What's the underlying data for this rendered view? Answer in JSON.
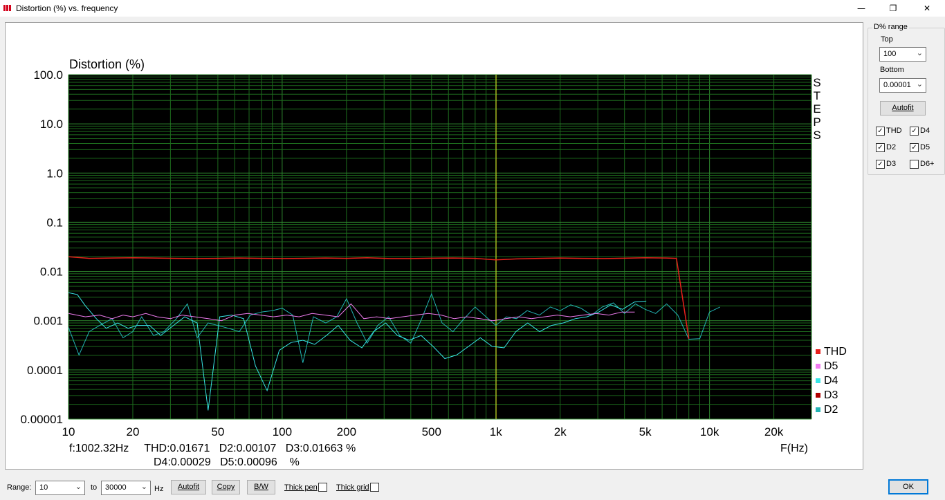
{
  "window": {
    "title": "Distortion (%) vs. frequency",
    "minimize": "—",
    "restore": "❐",
    "close": "✕"
  },
  "chart_data": {
    "type": "line",
    "title": "Distortion (%)",
    "xlabel": "F(Hz)",
    "ylabel": "",
    "x_scale": "log",
    "y_scale": "log",
    "xlim": [
      10,
      30000
    ],
    "ylim": [
      1e-05,
      100
    ],
    "x_ticks": [
      {
        "v": 10,
        "label": "10"
      },
      {
        "v": 20,
        "label": "20"
      },
      {
        "v": 50,
        "label": "50"
      },
      {
        "v": 100,
        "label": "100"
      },
      {
        "v": 200,
        "label": "200"
      },
      {
        "v": 500,
        "label": "500"
      },
      {
        "v": 1000,
        "label": "1k"
      },
      {
        "v": 2000,
        "label": "2k"
      },
      {
        "v": 5000,
        "label": "5k"
      },
      {
        "v": 10000,
        "label": "10k"
      },
      {
        "v": 20000,
        "label": "20k"
      }
    ],
    "y_ticks": [
      {
        "v": 100,
        "label": "100.0"
      },
      {
        "v": 10,
        "label": "10.0"
      },
      {
        "v": 1,
        "label": "1.0"
      },
      {
        "v": 0.1,
        "label": "0.1"
      },
      {
        "v": 0.01,
        "label": "0.01"
      },
      {
        "v": 0.001,
        "label": "0.001"
      },
      {
        "v": 0.0001,
        "label": "0.0001"
      },
      {
        "v": 1e-05,
        "label": "0.00001"
      }
    ],
    "grid": true,
    "cursor_x": 1002.32,
    "steps_label": "STEPS",
    "legend_position": "right-bottom",
    "series": [
      {
        "name": "THD",
        "color": "#e8201c",
        "x": [
          10,
          12.5,
          16,
          20,
          25,
          32,
          40,
          50,
          63,
          80,
          100,
          125,
          160,
          200,
          250,
          320,
          400,
          500,
          630,
          800,
          1000,
          1250,
          1600,
          2000,
          2500,
          3200,
          4000,
          5000,
          6300,
          7000,
          8000
        ],
        "y": [
          0.02,
          0.0185,
          0.0188,
          0.019,
          0.0188,
          0.0185,
          0.0183,
          0.0185,
          0.0188,
          0.0185,
          0.0183,
          0.0185,
          0.0188,
          0.0185,
          0.019,
          0.0183,
          0.0183,
          0.0186,
          0.0188,
          0.0185,
          0.0172,
          0.018,
          0.0185,
          0.0188,
          0.0185,
          0.0183,
          0.0186,
          0.019,
          0.0188,
          0.0185,
          0.00043
        ]
      },
      {
        "name": "D5",
        "color": "#f07cf0",
        "x": [
          10,
          12,
          14,
          16,
          18,
          20,
          23,
          26,
          30,
          34,
          39,
          45,
          52,
          60,
          69,
          79,
          91,
          105,
          120,
          138,
          159,
          183,
          210,
          241,
          277,
          318,
          366,
          420,
          483,
          555,
          638,
          733,
          842,
          968,
          1112,
          1278,
          1469,
          1688,
          1940,
          2229,
          2561,
          2943,
          3383,
          3887,
          4467
        ],
        "y": [
          0.0014,
          0.0012,
          0.0013,
          0.0011,
          0.0013,
          0.0012,
          0.0014,
          0.0012,
          0.0011,
          0.0013,
          0.0012,
          0.0011,
          0.001,
          0.0013,
          0.0014,
          0.0013,
          0.0012,
          0.0013,
          0.0012,
          0.0014,
          0.0013,
          0.0012,
          0.0022,
          0.0011,
          0.0012,
          0.0011,
          0.0012,
          0.0013,
          0.0014,
          0.0013,
          0.0011,
          0.0012,
          0.0011,
          0.001,
          0.0011,
          0.0012,
          0.0011,
          0.0012,
          0.0013,
          0.0012,
          0.0013,
          0.0014,
          0.0013,
          0.0015,
          0.0015
        ]
      },
      {
        "name": "D4",
        "color": "#38e6e6",
        "x": [
          10,
          11,
          12,
          13.5,
          15,
          17,
          19,
          21,
          24,
          27,
          31,
          35,
          40,
          45,
          51,
          58,
          66,
          75,
          85,
          97,
          110,
          125,
          142,
          161,
          183,
          208,
          236,
          268,
          305,
          346,
          393,
          447,
          508,
          577,
          655,
          745,
          846,
          961,
          1092,
          1241,
          1410,
          1602,
          1820,
          2068,
          2350,
          2670,
          3034,
          3447,
          3917,
          4451,
          5058
        ],
        "y": [
          0.0037,
          0.0034,
          0.002,
          0.0011,
          0.0007,
          0.0009,
          0.0007,
          0.0008,
          0.0008,
          0.0005,
          0.0008,
          0.0012,
          0.0009,
          1.5e-05,
          0.0012,
          0.0013,
          0.0011,
          0.00012,
          3.8e-05,
          0.00025,
          0.00036,
          0.0004,
          0.00033,
          0.0005,
          0.0008,
          0.0004,
          0.00028,
          0.0006,
          0.0009,
          0.0005,
          0.0004,
          0.0005,
          0.0003,
          0.00017,
          0.0002,
          0.0003,
          0.00045,
          0.0003,
          0.00028,
          0.0006,
          0.0009,
          0.0006,
          0.0008,
          0.0009,
          0.0011,
          0.0012,
          0.0015,
          0.0021,
          0.0017,
          0.0024,
          0.0025
        ]
      },
      {
        "name": "D3",
        "color": "#b00000",
        "x": [
          7000,
          8000
        ],
        "y": [
          0.0185,
          0.00043
        ]
      },
      {
        "name": "D2",
        "color": "#23b5b5",
        "x": [
          10,
          11.2,
          12.5,
          14,
          16,
          18,
          20,
          22,
          25,
          28,
          32,
          36,
          40,
          45,
          50,
          56,
          63,
          71,
          80,
          90,
          100,
          112,
          125,
          140,
          160,
          180,
          200,
          224,
          250,
          280,
          315,
          355,
          400,
          450,
          500,
          560,
          630,
          710,
          800,
          900,
          1000,
          1120,
          1250,
          1400,
          1600,
          1800,
          2000,
          2240,
          2500,
          2800,
          3150,
          3550,
          4000,
          4500,
          5000,
          5600,
          6300,
          7100,
          8000,
          9000,
          10000,
          11200
        ],
        "y": [
          0.00073,
          0.0002,
          0.0006,
          0.0008,
          0.0011,
          0.00045,
          0.0006,
          0.0012,
          0.0005,
          0.0006,
          0.0011,
          0.0022,
          0.00045,
          0.0009,
          0.0008,
          0.0007,
          0.0006,
          0.0013,
          0.0015,
          0.0016,
          0.0018,
          0.0013,
          0.00014,
          0.0012,
          0.0009,
          0.0012,
          0.0028,
          0.0009,
          0.00035,
          0.0008,
          0.0012,
          0.0005,
          0.00035,
          0.0011,
          0.0035,
          0.0009,
          0.0006,
          0.0011,
          0.0019,
          0.0012,
          0.0008,
          0.0012,
          0.0011,
          0.0016,
          0.0013,
          0.0019,
          0.0016,
          0.0021,
          0.0018,
          0.0013,
          0.0019,
          0.0023,
          0.0014,
          0.0022,
          0.0017,
          0.0014,
          0.0022,
          0.0013,
          0.00042,
          0.00043,
          0.0015,
          0.0019
        ]
      }
    ]
  },
  "readout": {
    "line1": "f:1002.32Hz     THD:0.01671   D2:0.00107   D3:0.01663 %",
    "line2": "D4:0.00029   D5:0.00096    %"
  },
  "side": {
    "group_title": "D% range",
    "top_label": "Top",
    "top_value": "100",
    "bottom_label": "Bottom",
    "bottom_value": "0.00001",
    "autofit": "Autofit",
    "checks": [
      {
        "label": "THD",
        "checked": true
      },
      {
        "label": "D4",
        "checked": true
      },
      {
        "label": "D2",
        "checked": true
      },
      {
        "label": "D5",
        "checked": true
      },
      {
        "label": "D3",
        "checked": true
      },
      {
        "label": "D6+",
        "checked": false
      }
    ]
  },
  "bottom": {
    "range_label": "Range:",
    "from_value": "10",
    "to_label": "to",
    "to_value": "30000",
    "hz_label": "Hz",
    "autofit": "Autofit",
    "copy": "Copy",
    "bw": "B/W",
    "thick_pen": "Thick pen",
    "thick_grid": "Thick grid",
    "ok": "OK"
  }
}
